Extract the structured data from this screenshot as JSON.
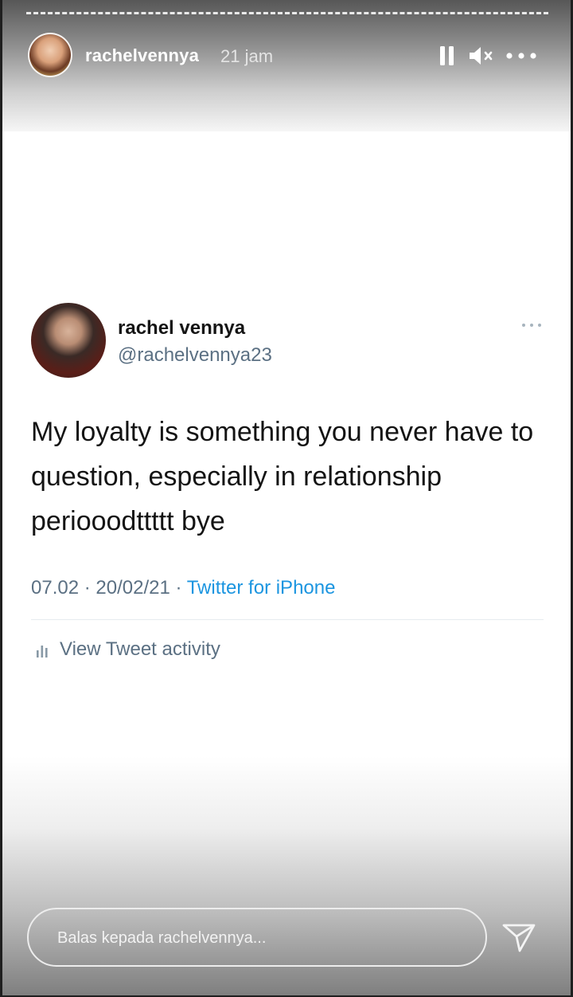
{
  "story": {
    "username": "rachelvennya",
    "time_ago": "21 jam",
    "controls": {
      "pause_icon": "pause-icon",
      "mute_icon": "speaker-muted-icon",
      "more_icon": "more-horizontal-icon"
    }
  },
  "tweet": {
    "display_name": "rachel vennya",
    "handle": "@rachelvennya23",
    "text": "My loyalty is something you never have to question, especially in relationship periooodttttt bye",
    "timestamp": "07.02 · 20/02/21 · ",
    "source": "Twitter for iPhone",
    "activity_label": "View Tweet activity"
  },
  "reply": {
    "placeholder": "Balas kepada rachelvennya...",
    "send_icon": "send-icon"
  },
  "colors": {
    "tweet_text": "#141414",
    "muted_text": "#5b7083",
    "link": "#1b95e0"
  }
}
